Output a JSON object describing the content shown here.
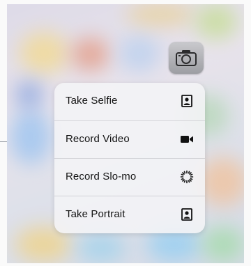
{
  "quick_actions": {
    "items": [
      {
        "label": "Take Selfie",
        "icon": "selfie-portrait-icon"
      },
      {
        "label": "Record Video",
        "icon": "video-camera-icon"
      },
      {
        "label": "Record Slo-mo",
        "icon": "slo-mo-icon"
      },
      {
        "label": "Take Portrait",
        "icon": "portrait-icon"
      }
    ]
  },
  "app_icon": {
    "name": "camera-app-icon"
  }
}
